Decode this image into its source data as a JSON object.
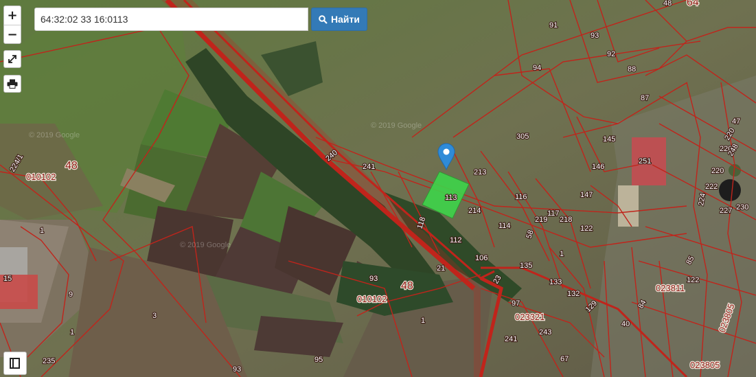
{
  "search": {
    "value": "64:32:02 33 16:0113",
    "button_label": "Найти"
  },
  "controls": {
    "zoom_in": "+",
    "zoom_out": "−"
  },
  "watermarks": [
    "© 2019 Google",
    "© 2019 Google",
    "© 2019 Google"
  ],
  "quarters": [
    "48",
    "010102",
    "48",
    "010102",
    "64",
    "023811",
    "023321",
    "023805",
    "023805"
  ],
  "selected_parcel": "113",
  "parcels": [
    "91",
    "93",
    "48",
    "94",
    "92",
    "88",
    "87",
    "305",
    "145",
    "146",
    "251",
    "147",
    "213",
    "116",
    "214",
    "117",
    "219",
    "218",
    "122",
    "114",
    "58",
    "118",
    "112",
    "106",
    "135",
    "21",
    "133",
    "132",
    "129",
    "23",
    "97",
    "243",
    "241",
    "67",
    "241",
    "240",
    "224/1",
    "1",
    "15",
    "9",
    "1",
    "3",
    "93",
    "235",
    "93",
    "1",
    "95",
    "1",
    "122",
    "85",
    "84",
    "40",
    "47",
    "220",
    "220",
    "222",
    "224",
    "227",
    "230",
    "248",
    "220",
    "210"
  ],
  "colors": {
    "boundary": "#c0241b",
    "selected_fill": "#3ed44a",
    "marker": "#2f8bd8",
    "search_button": "#337ab7"
  }
}
